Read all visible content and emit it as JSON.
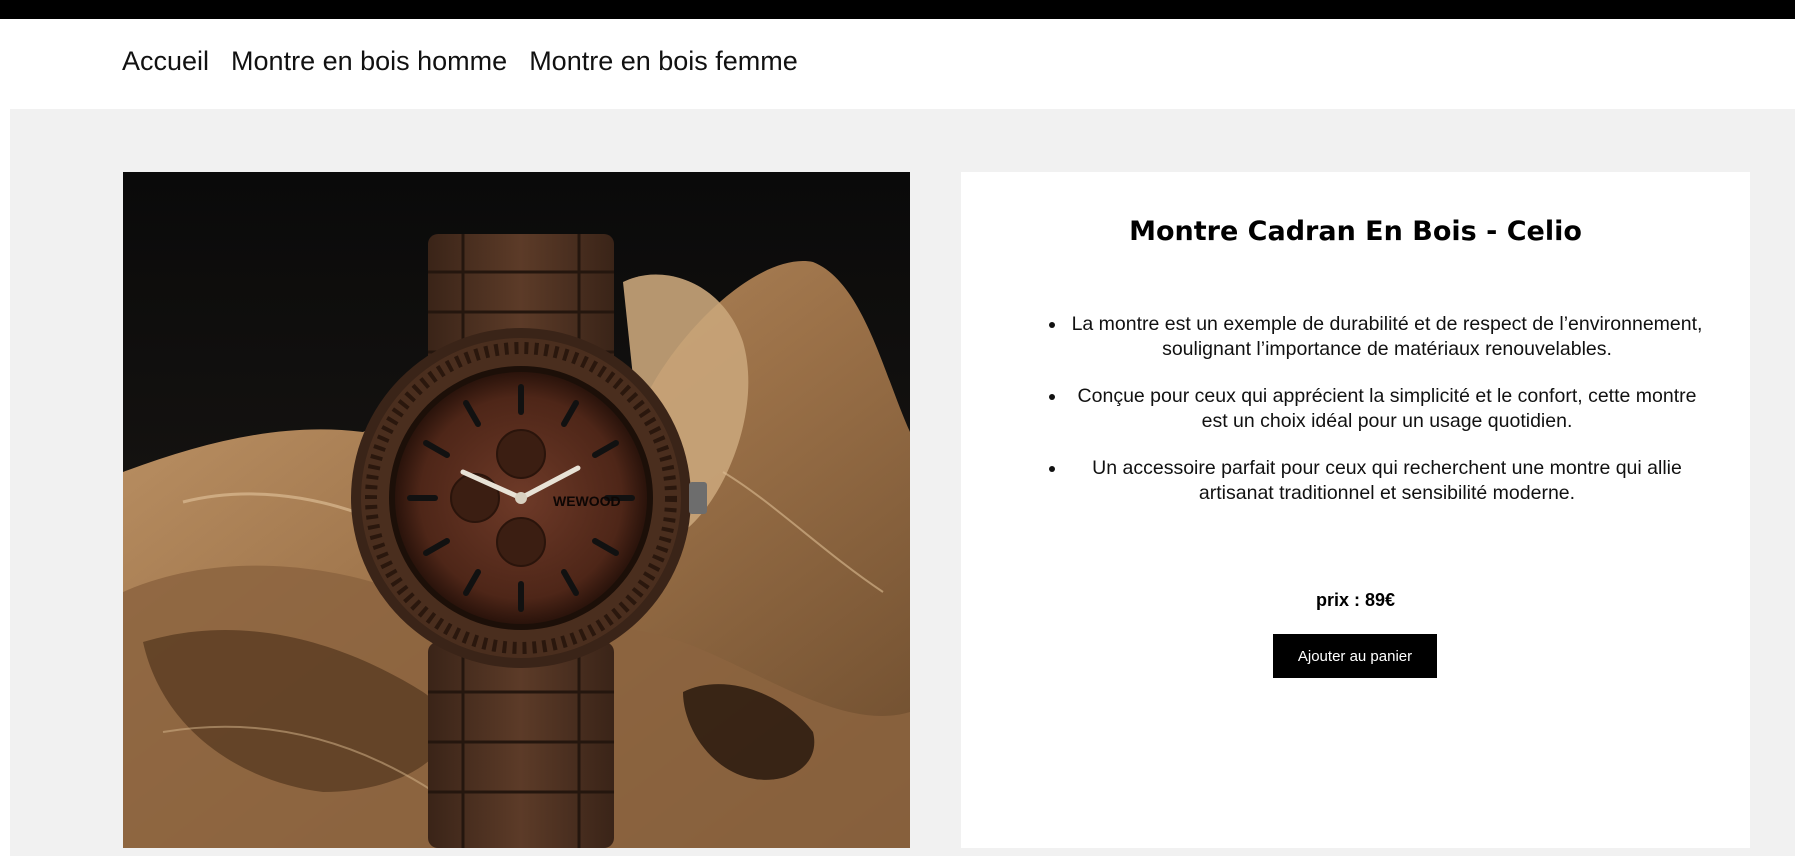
{
  "nav": {
    "items": [
      {
        "label": "Accueil"
      },
      {
        "label": "Montre en bois homme"
      },
      {
        "label": "Montre en bois femme"
      }
    ]
  },
  "product": {
    "image_brand": "WEWOOD",
    "title": "Montre Cadran En Bois - Celio",
    "features": [
      "La montre est un exemple de durabilité et de respect de l’environnement, soulignant l’importance de matériaux renouvelables.",
      "Conçue pour ceux qui apprécient la simplicité et le confort, cette montre est un choix idéal pour un usage quotidien.",
      "Un accessoire parfait pour ceux qui recherchent une montre qui allie artisanat traditionnel et sensibilité moderne."
    ],
    "price": "prix : 89€",
    "add_to_cart_label": "Ajouter au panier"
  },
  "colors": {
    "top_bar": "#000000",
    "page_background": "#f1f1f1",
    "card_background": "#ffffff",
    "button_background": "#000000",
    "button_text": "#ffffff"
  }
}
